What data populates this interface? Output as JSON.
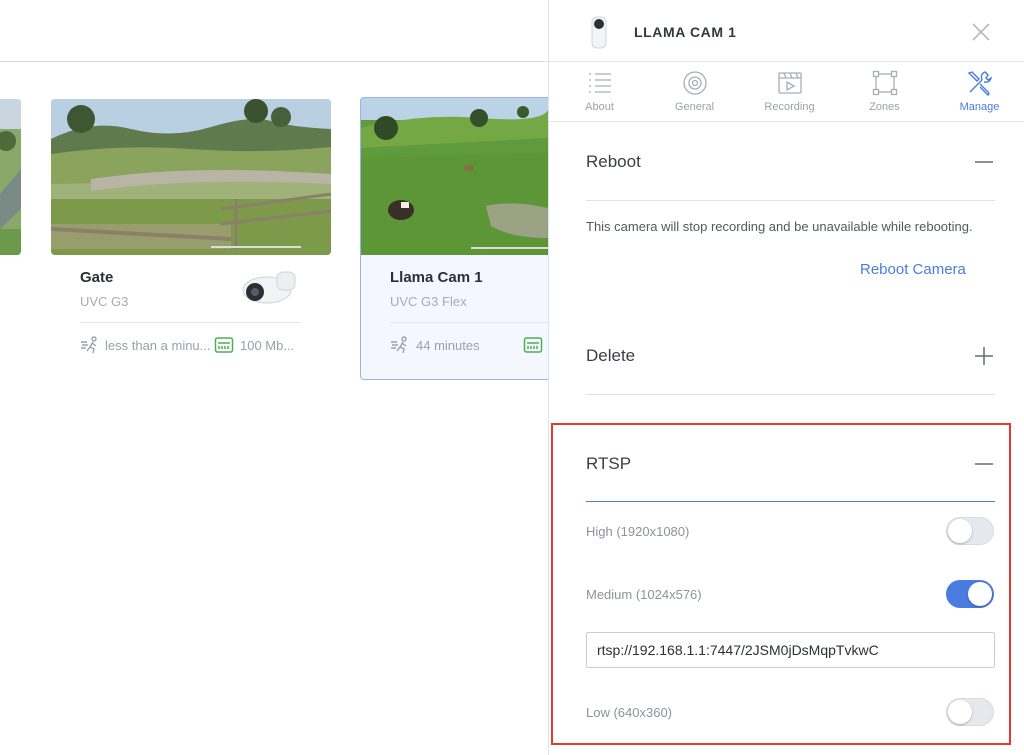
{
  "cameras": [
    {
      "name": "Gate",
      "model": "UVC G3",
      "motion": "less than a minu...",
      "bandwidth": "100 Mb..."
    },
    {
      "name": "Llama Cam 1",
      "model": "UVC G3 Flex",
      "motion": "44 minutes"
    }
  ],
  "panel": {
    "title": "LLAMA CAM 1",
    "tabs": [
      {
        "label": "About",
        "icon": "list-icon"
      },
      {
        "label": "General",
        "icon": "camera-lens-icon"
      },
      {
        "label": "Recording",
        "icon": "film-play-icon"
      },
      {
        "label": "Zones",
        "icon": "zones-icon"
      },
      {
        "label": "Manage",
        "icon": "tools-icon",
        "active": true
      }
    ],
    "reboot": {
      "title": "Reboot",
      "description": "This camera will stop recording and be unavailable while rebooting.",
      "button": "Reboot Camera",
      "expanded": true
    },
    "delete": {
      "title": "Delete",
      "expanded": false
    },
    "rtsp": {
      "title": "RTSP",
      "expanded": true,
      "high": {
        "label": "High (1920x1080)",
        "enabled": false
      },
      "medium": {
        "label": "Medium (1024x576)",
        "enabled": true,
        "url": "rtsp://192.168.1.1:7447/2JSM0jDsMqpTvkwC"
      },
      "low": {
        "label": "Low (640x360)",
        "enabled": false
      }
    }
  },
  "colors": {
    "accent": "#4a7cdf",
    "highlight": "#e53935",
    "motion_icon": "#9aa0ab",
    "network_icon": "#4caf50"
  }
}
